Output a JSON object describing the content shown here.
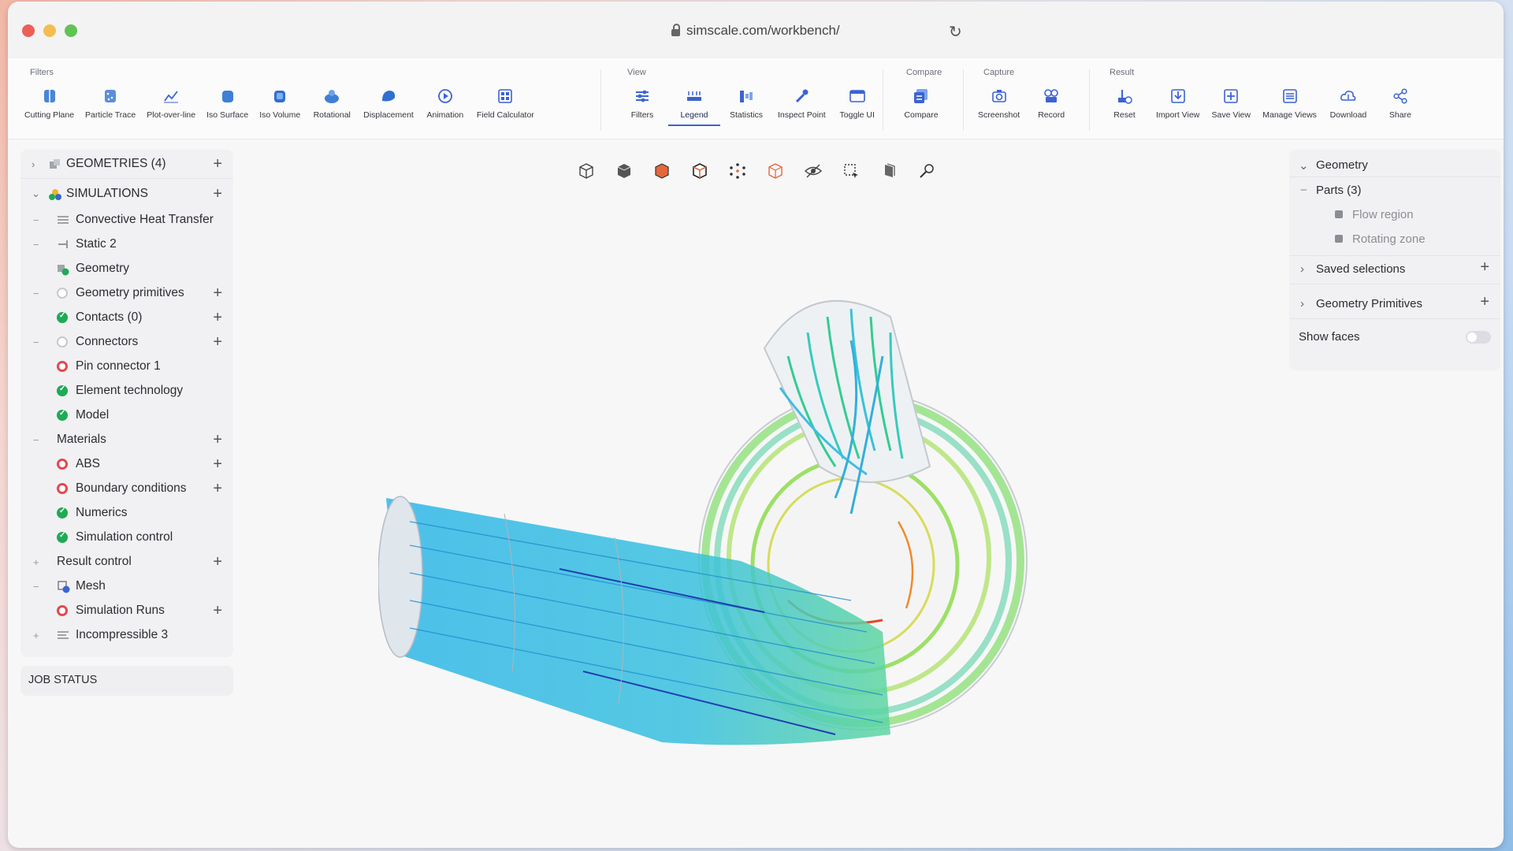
{
  "browser": {
    "url": "simscale.com/workbench/"
  },
  "toolbar": {
    "groups": [
      {
        "title": "Filters",
        "tools": [
          "Cutting Plane",
          "Particle Trace",
          "Plot-over-line",
          "Iso Surface",
          "Iso Volume",
          "Rotational",
          "Displacement",
          "Animation",
          "Field Calculator"
        ]
      },
      {
        "title": "View",
        "tools": [
          "Filters",
          "Legend",
          "Statistics",
          "Inspect Point",
          "Toggle UI"
        ]
      },
      {
        "title": "Compare",
        "tools": [
          "Compare"
        ]
      },
      {
        "title": "Capture",
        "tools": [
          "Screenshot",
          "Record"
        ]
      },
      {
        "title": "Result",
        "tools": [
          "Reset",
          "Import View",
          "Save View",
          "Manage Views",
          "Download",
          "Share"
        ]
      }
    ],
    "active_tool": "Legend"
  },
  "tree": {
    "geometries": "GEOMETRIES (4)",
    "simulations": "SIMULATIONS",
    "items": [
      "Convective Heat Transfer",
      "Static 2",
      "Geometry",
      "Geometry primitives",
      "Contacts (0)",
      "Connectors",
      "Pin connector 1",
      "Element technology",
      "Model",
      "Materials",
      "ABS",
      "Boundary conditions",
      "Numerics",
      "Simulation control",
      "Result control",
      "Mesh",
      "Simulation Runs",
      "Incompressible 3"
    ]
  },
  "job_status": "JOB STATUS",
  "right_panel": {
    "geometry": "Geometry",
    "parts": "Parts (3)",
    "flow_region": "Flow region",
    "rotating_zone": "Rotating zone",
    "saved_selections": "Saved selections",
    "geometry_primitives": "Geometry Primitives",
    "show_faces": "Show faces"
  },
  "colors": {
    "accent": "#3b63d3",
    "ok": "#1faa55",
    "error": "#e5484d"
  }
}
